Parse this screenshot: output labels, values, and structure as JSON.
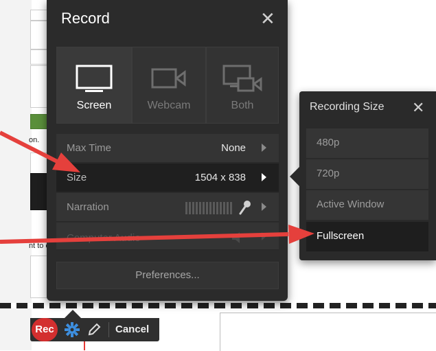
{
  "record_panel": {
    "title": "Record",
    "sources": [
      {
        "label": "Screen",
        "icon": "monitor-icon",
        "active": true
      },
      {
        "label": "Webcam",
        "icon": "camera-icon",
        "active": false
      },
      {
        "label": "Both",
        "icon": "screen-and-camera-icon",
        "active": false
      }
    ],
    "options": [
      {
        "label": "Max Time",
        "value": "None"
      },
      {
        "label": "Size",
        "value": "1504 x 838"
      },
      {
        "label": "Narration",
        "value": ""
      },
      {
        "label": "Computer Audio",
        "value": ""
      }
    ],
    "preferences_label": "Preferences..."
  },
  "size_panel": {
    "title": "Recording Size",
    "options": [
      "480p",
      "720p",
      "Active Window",
      "Fullscreen"
    ],
    "selected": "Fullscreen"
  },
  "toolbar": {
    "rec_label": "Rec",
    "cancel_label": "Cancel"
  },
  "background": {
    "partial_text_1": "on.",
    "partial_text_2": "nt to ca"
  },
  "colors": {
    "accent_red": "#e53935",
    "panel_bg": "#2b2b2b",
    "toolbar_gear": "#3d8fe0"
  }
}
